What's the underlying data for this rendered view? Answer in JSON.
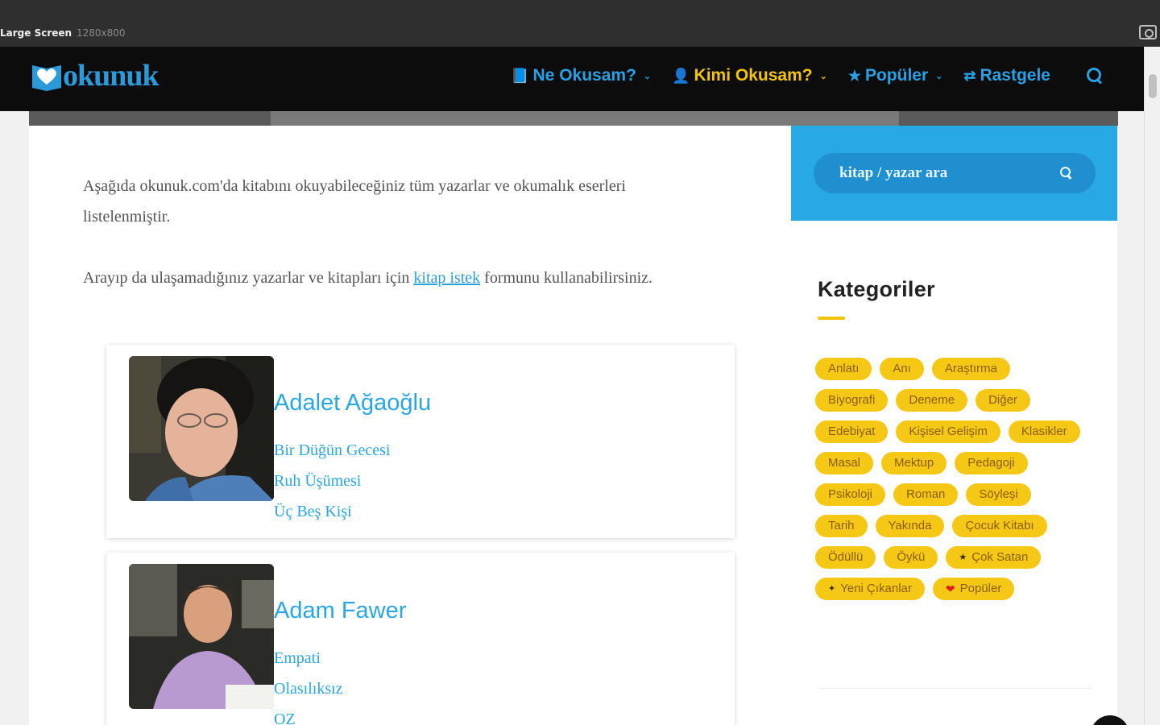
{
  "chrome": {
    "screen_label": "Large Screen",
    "screen_size": "1280x800"
  },
  "logo": {
    "text": "okunuk"
  },
  "nav": {
    "items": [
      {
        "label": "Ne Okusam?",
        "icon": "book-icon",
        "dropdown": true
      },
      {
        "label": "Kimi Okusam?",
        "icon": "user-icon",
        "dropdown": true
      },
      {
        "label": "Popüler",
        "icon": "star-icon",
        "dropdown": true
      },
      {
        "label": "Rastgele",
        "icon": "shuffle-icon",
        "dropdown": false
      }
    ],
    "search_icon": "search-icon"
  },
  "intro": {
    "p1": "Aşağıda okunuk.com'da kitabını okuyabileceğiniz tüm yazarlar ve okumalık eserleri listelenmiştir.",
    "p2_before": "Arayıp da ulaşamadığınız yazarlar ve kitapları için ",
    "p2_link": "kitap istek",
    "p2_after": " formunu kullanabilirsiniz."
  },
  "authors": [
    {
      "name": "Adalet Ağaoğlu",
      "books": [
        "Bir Düğün Gecesi",
        "Ruh Üşümesi",
        "Üç Beş Kişi"
      ]
    },
    {
      "name": "Adam Fawer",
      "books": [
        "Empati",
        "Olasılıksız",
        "OZ"
      ]
    }
  ],
  "sidebar": {
    "search_placeholder": "kitap / yazar ara",
    "categories_title": "Kategoriler",
    "tags": [
      "Anlatı",
      "Anı",
      "Araştırma",
      "Biyografi",
      "Deneme",
      "Diğer",
      "Edebiyat",
      "Kişisel Gelişim",
      "Klasikler",
      "Masal",
      "Mektup",
      "Pedagoji",
      "Psikoloji",
      "Roman",
      "Söyleşi",
      "Tarih",
      "Yakında",
      "Çocuk Kitabı",
      "Ödüllü",
      "Öykü",
      "Çok Satan",
      "Yeni Çıkanlar",
      "Popüler"
    ]
  },
  "colors": {
    "brand_blue": "#29a0e4",
    "brand_yellow": "#f2c500",
    "nav_bg": "#0c0c0c"
  }
}
